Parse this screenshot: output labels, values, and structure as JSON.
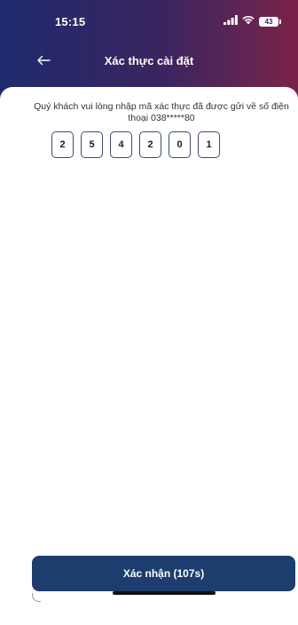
{
  "status_bar": {
    "time": "15:15",
    "battery": "43",
    "icons": [
      "signal-icon",
      "wifi-icon",
      "battery-icon"
    ]
  },
  "nav": {
    "back_icon": "arrow-left-icon",
    "title": "Xác thực cài đặt"
  },
  "main": {
    "instruction": "Quý khách vui lòng nhập mã xác thực đã được gửi về số điện thoại 038*****80",
    "otp_digits": [
      "2",
      "5",
      "4",
      "2",
      "0",
      "1"
    ]
  },
  "footer": {
    "confirm_label": "Xác nhận (107s)"
  },
  "colors": {
    "header_start": "#1f2a6d",
    "header_end": "#7a2349",
    "button": "#1d3d6f",
    "otp_border": "#3d4a7a"
  }
}
